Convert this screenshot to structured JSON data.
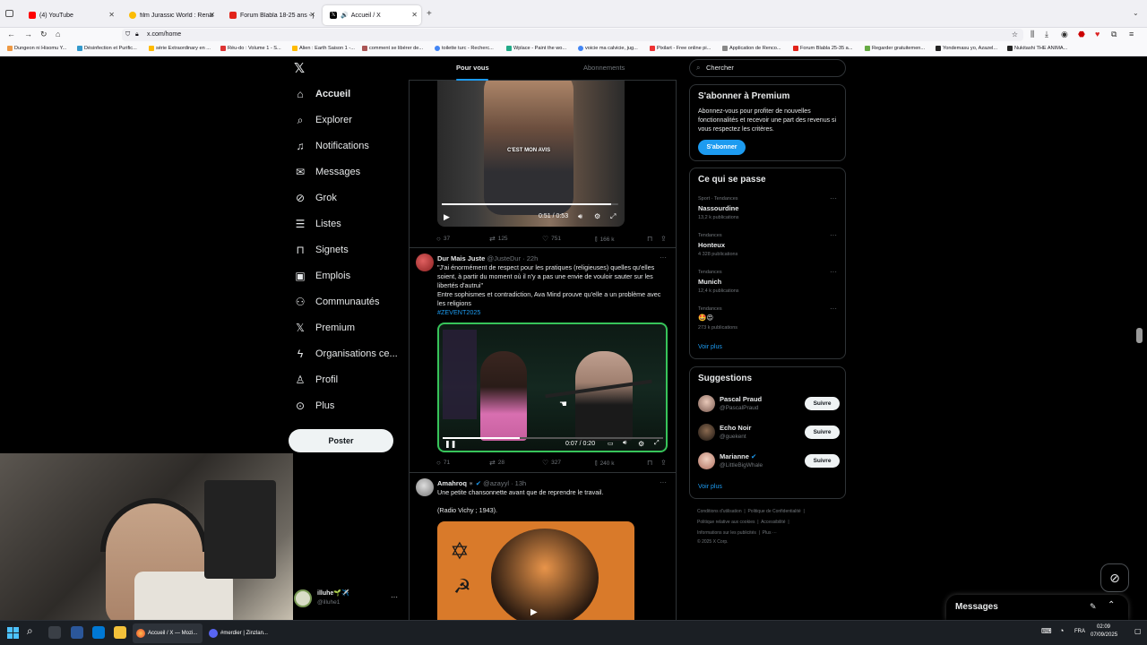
{
  "browser": {
    "tabs": [
      {
        "label": "(4) YouTube",
        "color": "#ff0000"
      },
      {
        "label": "film Jurassic World : Renaissance",
        "color": "#ffd400"
      },
      {
        "label": "Forum Blabla 18-25 ans - jeuxv",
        "color": "#e2231a"
      },
      {
        "label": "Accueil / X",
        "color": "#000000"
      }
    ],
    "url": "x.com/home",
    "bookmarks": [
      "Dungeon ni Hisomu Y...",
      "Désinfection et Purific...",
      "série Extraordinary en ...",
      "Réu-do : Volume 1 - S...",
      "Alien : Earth Saison 1 -...",
      "comment se libérer de...",
      "toilette turc - Recherc...",
      "Wplace - Paint the wo...",
      "voicie ma calvicie, jug...",
      "Pixilart - Free online pi...",
      "Application de Renco...",
      "Forum Blabla 25-35 a...",
      "Regarder gratuitemen...",
      "Yondemasu yo, Azazel...",
      "Nukitashi THE ANIMA..."
    ]
  },
  "nav": {
    "items": [
      {
        "label": "Accueil",
        "icon": "home-icon"
      },
      {
        "label": "Explorer",
        "icon": "search-icon"
      },
      {
        "label": "Notifications",
        "icon": "bell-icon"
      },
      {
        "label": "Messages",
        "icon": "envelope-icon"
      },
      {
        "label": "Grok",
        "icon": "grok-icon"
      },
      {
        "label": "Listes",
        "icon": "list-icon"
      },
      {
        "label": "Signets",
        "icon": "bookmark-icon"
      },
      {
        "label": "Emplois",
        "icon": "briefcase-icon"
      },
      {
        "label": "Communautés",
        "icon": "people-icon"
      },
      {
        "label": "Premium",
        "icon": "x-logo-icon"
      },
      {
        "label": "Organisations ce...",
        "icon": "lightning-icon"
      },
      {
        "label": "Profil",
        "icon": "person-icon"
      },
      {
        "label": "Plus",
        "icon": "more-circle-icon"
      }
    ],
    "post_label": "Poster",
    "account": {
      "name": "illuhe🌱✈️",
      "handle": "@illuhe1"
    }
  },
  "timeline": {
    "tabs": [
      "Pour vous",
      "Abonnements"
    ],
    "tweet1": {
      "caption": "C'EST MON AVIS",
      "time": "0:51 / 0:53",
      "replies": "37",
      "retweets": "125",
      "likes": "751",
      "views": "166 k"
    },
    "tweet2": {
      "name": "Dur Mais Juste",
      "handle": "@JusteDur · 22h",
      "text1": "\"J'ai énormément de respect pour les pratiques (religieuses) quelles qu'elles soient, à partir du moment où il n'y a pas une envie de vouloir sauter sur les libertés d'autrui\"",
      "text2": "Entre sophismes et contradiction, Ava Mind prouve qu'elle a un problème avec les religions",
      "hashtag": "#ZEVENT2025",
      "time": "0:07 / 0:20",
      "replies": "71",
      "retweets": "28",
      "likes": "327",
      "views": "240 k"
    },
    "tweet3": {
      "name": "Amahroq ♅",
      "handle": "@azayyl · 13h",
      "text1": "Une petite chansonnette avant que de reprendre le travail.",
      "text2": "(Radio Vichy ; 1943)."
    }
  },
  "sidebar": {
    "search_placeholder": "Chercher",
    "premium": {
      "title": "S'abonner à Premium",
      "body": "Abonnez-vous pour profiter de nouvelles fonctionnalités et recevoir une part des revenus si vous respectez les critères.",
      "button": "S'abonner"
    },
    "trends": {
      "title": "Ce qui se passe",
      "items": [
        {
          "category": "Sport · Tendances",
          "name": "Nassourdine",
          "count": "13,2 k publications"
        },
        {
          "category": "Tendances",
          "name": "Honteux",
          "count": "4 328 publications"
        },
        {
          "category": "Tendances",
          "name": "Munich",
          "count": "12,4 k publications"
        },
        {
          "category": "Tendances",
          "name": "🤩😍",
          "count": "273 k publications"
        }
      ],
      "more": "Voir plus"
    },
    "suggestions": {
      "title": "Suggestions",
      "items": [
        {
          "name": "Pascal Praud",
          "handle": "@PascalPraud",
          "button": "Suivre"
        },
        {
          "name": "Echo Noir",
          "handle": "@guekent",
          "button": "Suivre"
        },
        {
          "name": "Marianne",
          "handle": "@LittleBigWhale",
          "button": "Suivre"
        }
      ],
      "more": "Voir plus"
    },
    "footer": {
      "line1a": "Conditions d'utilisation",
      "line1b": "Politique de Confidentialité",
      "line2a": "Politique relative aux cookies",
      "line2b": "Accessibilité",
      "line3a": "Informations sur les publicités",
      "line3b": "Plus ···",
      "line4": "© 2025 X Corp."
    },
    "messages_label": "Messages"
  },
  "taskbar": {
    "apps": [
      "Accueil / X — Mozi...",
      "#merdier | Zinzlan..."
    ],
    "lang": "FRA",
    "time": "02:09",
    "date": "07/09/2025"
  },
  "colors": {
    "accent": "#1d9bf0",
    "bg": "#000000",
    "border": "#2f3336",
    "muted": "#71767b"
  }
}
